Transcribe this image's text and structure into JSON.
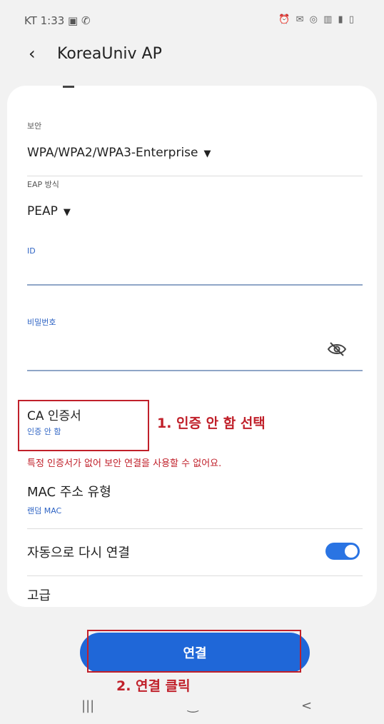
{
  "status": {
    "left": "KT 1:33 ▣ ✆",
    "right": "⏰ ✉ ◎ ▥ ▮ ▯"
  },
  "appbar": {
    "back_icon": "chevron-left-icon",
    "title": "KoreaUniv AP"
  },
  "form": {
    "security_label": "보안",
    "security_value": "WPA/WPA2/WPA3-Enterprise",
    "eap_label": "EAP 방식",
    "eap_value": "PEAP",
    "id_label": "ID",
    "password_label": "비밀번호",
    "ca_title": "CA 인증서",
    "ca_value": "인증 안 함",
    "warning": "특정 인증서가 없어 보안 연결을 사용할 수 없어요.",
    "mac_title": "MAC 주소 유형",
    "mac_value": "랜덤 MAC",
    "auto_reconnect": "자동으로 다시 연결",
    "advanced": "고급"
  },
  "annotations": {
    "step1": "1. 인증 안 함 선택",
    "step2": "2. 연결 클릭"
  },
  "connect_label": "연결",
  "navbar": {
    "recent": "|||",
    "home": "‿",
    "back": "<"
  },
  "colors": {
    "accent": "#1f67d8",
    "annotation": "#c0202a",
    "toggle_on": "#2a74e3"
  },
  "toggle_state": true
}
